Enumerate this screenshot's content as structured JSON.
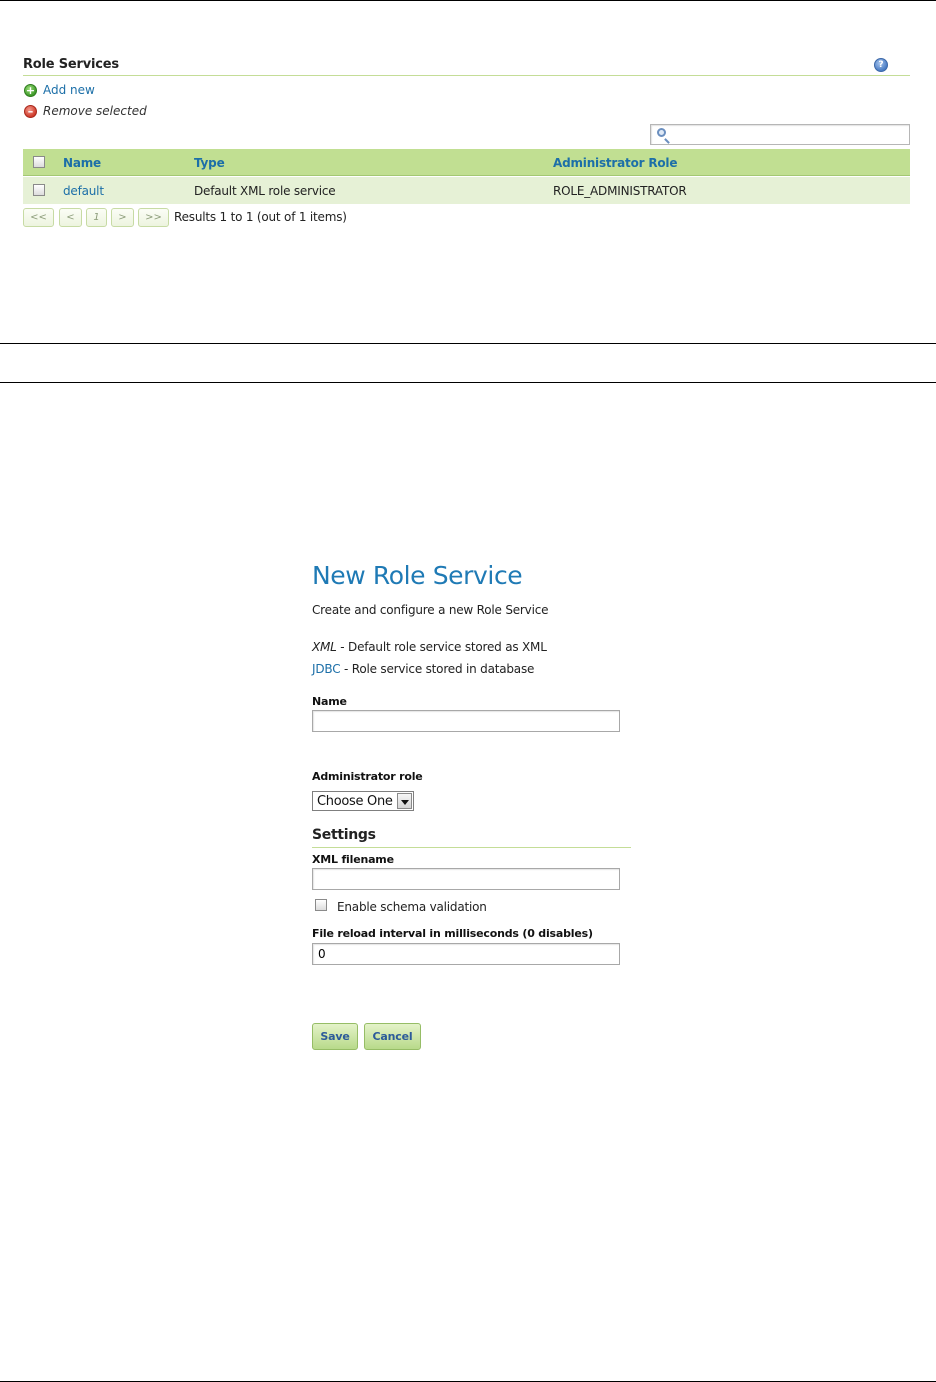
{
  "role_services": {
    "title": "Role Services",
    "help_icon": "help-icon",
    "add_new_label": "Add new",
    "remove_selected_label": "Remove selected",
    "search": {
      "value": "",
      "placeholder": ""
    },
    "columns": [
      "Name",
      "Type",
      "Administrator Role"
    ],
    "rows": [
      {
        "name": "default",
        "type": "Default XML role service",
        "admin_role": "ROLE_ADMINISTRATOR"
      }
    ],
    "pager": {
      "first": "<<",
      "prev": "<",
      "page": "1",
      "next": ">",
      "last": ">>",
      "results": "Results 1 to 1 (out of 1 items)"
    }
  },
  "new_role_service": {
    "title": "New Role Service",
    "description": "Create and configure a new Role Service",
    "options": [
      {
        "name": "XML",
        "desc": " - Default role service stored as XML"
      },
      {
        "name": "JDBC",
        "desc": " - Role service stored in database"
      }
    ],
    "name_label": "Name",
    "name_value": "",
    "admin_role_label": "Administrator role",
    "admin_role_selected": "Choose One",
    "settings_title": "Settings",
    "xml_filename_label": "XML filename",
    "xml_filename_value": "",
    "schema_validation_label": "Enable schema validation",
    "reload_interval_label": "File reload interval in milliseconds (0 disables)",
    "reload_interval_value": "0",
    "save_label": "Save",
    "cancel_label": "Cancel"
  },
  "colors": {
    "link": "#1c6fa8",
    "title": "#1f7ab5",
    "table_header": "#c1df92",
    "table_row": "#e6f1d6"
  }
}
